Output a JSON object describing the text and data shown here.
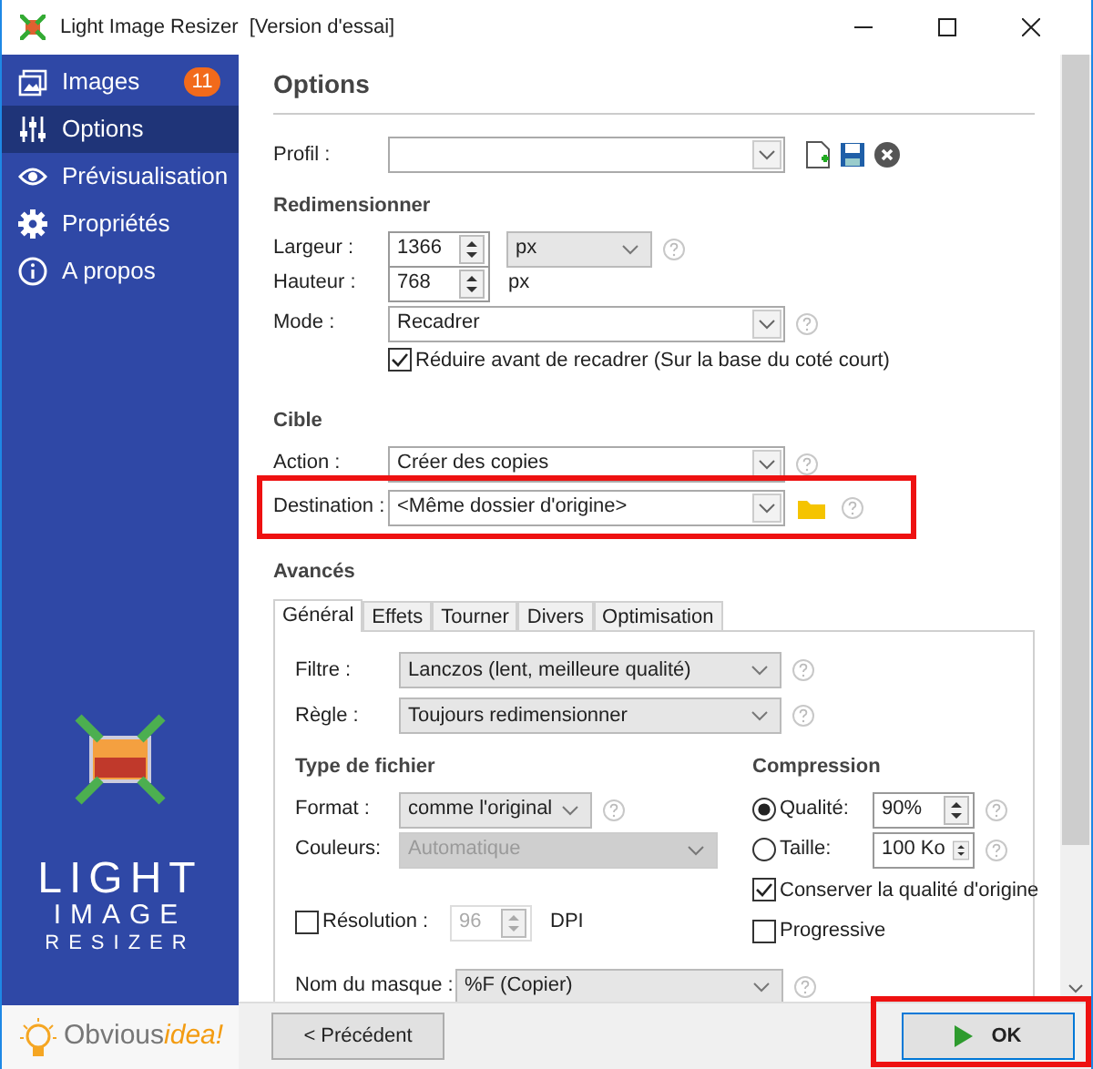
{
  "window": {
    "title": "Light Image Resizer",
    "subtitle": "[Version d'essai]"
  },
  "sidebar": {
    "items": [
      {
        "label": "Images",
        "selected": false,
        "badge": "11"
      },
      {
        "label": "Options",
        "selected": true
      },
      {
        "label": "Prévisualisation",
        "selected": false
      },
      {
        "label": "Propriétés",
        "selected": false
      },
      {
        "label": "A propos",
        "selected": false
      }
    ],
    "logo": [
      "LIGHT",
      "IMAGE",
      "RESIZER"
    ],
    "brand": {
      "part_1": "Obvious",
      "part_2": "idea!"
    }
  },
  "page_title": "Options",
  "profile": {
    "label": "Profil :"
  },
  "resize": {
    "heading": "Redimensionner",
    "width": {
      "label": "Largeur :",
      "value": "1366",
      "unit": "px"
    },
    "height": {
      "label": "Hauteur :",
      "value": "768",
      "unit": "px"
    },
    "mode": {
      "label": "Mode :",
      "value": "Recadrer"
    },
    "reduce": {
      "label": "Réduire avant de recadrer (Sur la base du coté court)",
      "checked": true
    }
  },
  "target": {
    "heading": "Cible",
    "action": {
      "label": "Action :",
      "value": "Créer des copies"
    },
    "destination": {
      "label": "Destination :",
      "value": "<Même dossier d'origine>",
      "highlighted": true
    }
  },
  "advanced": {
    "heading": "Avancés",
    "tabs": [
      {
        "label": "Général",
        "selected": true
      },
      {
        "label": "Effets",
        "selected": false
      },
      {
        "label": "Tourner",
        "selected": false
      },
      {
        "label": "Divers",
        "selected": false
      },
      {
        "label": "Optimisation",
        "selected": false
      }
    ],
    "filter": {
      "label": "Filtre :",
      "value": "Lanczos  (lent, meilleure qualité)"
    },
    "rule": {
      "label": "Règle :",
      "value": "Toujours redimensionner"
    },
    "file_type": {
      "heading": "Type de fichier",
      "format": {
        "label": "Format :",
        "value": "comme l'original"
      },
      "colors": {
        "label": "Couleurs:",
        "value": "Automatique",
        "disabled": true
      }
    },
    "resolution": {
      "label": "Résolution :",
      "checked": false,
      "value": "96",
      "unit": "DPI",
      "disabled": true
    },
    "compression": {
      "heading": "Compression",
      "quality": {
        "label": "Qualité:",
        "selected": true,
        "value": "90%"
      },
      "size": {
        "label": "Taille:",
        "selected": false,
        "value": "100 Ko"
      },
      "keep_quality": {
        "label": "Conserver la qualité d'origine",
        "checked": true
      },
      "progressive": {
        "label": "Progressive",
        "checked": false
      }
    },
    "mask": {
      "label": "Nom du masque :",
      "value": "%F (Copier)"
    }
  },
  "buttons": {
    "previous": {
      "label": "< Précédent"
    },
    "ok": {
      "label": "OK",
      "highlighted": true
    }
  }
}
